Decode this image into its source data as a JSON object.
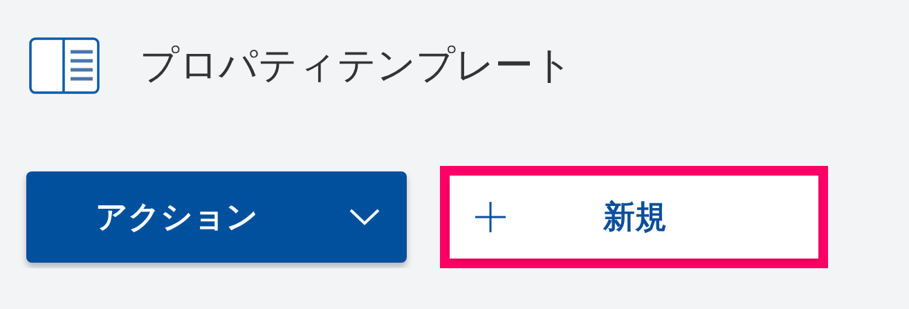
{
  "header": {
    "title": "プロパティテンプレート"
  },
  "buttons": [
    {
      "kind": "dropdown",
      "label": "アクション",
      "highlighted": false
    },
    {
      "kind": "add",
      "label": "新規",
      "highlighted": true
    }
  ]
}
